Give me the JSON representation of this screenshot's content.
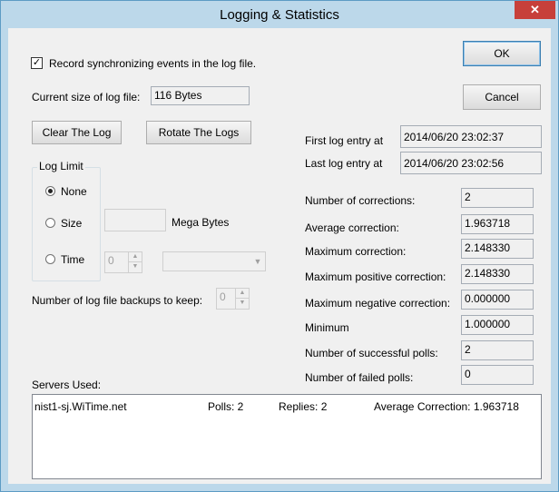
{
  "window": {
    "title": "Logging & Statistics",
    "close_glyph": "✕"
  },
  "buttons": {
    "ok": "OK",
    "cancel": "Cancel",
    "clear_log": "Clear The Log",
    "rotate_logs": "Rotate The Logs"
  },
  "record_events": {
    "checked": true,
    "check_glyph": "✓",
    "label": "Record synchronizing events in the log file."
  },
  "log_size": {
    "label": "Current size of log file:",
    "value": "116 Bytes"
  },
  "log_limit": {
    "group_label": "Log Limit",
    "selected": "None",
    "options": {
      "none": "None",
      "size": "Size",
      "time": "Time"
    },
    "size_value": "",
    "size_unit": "Mega Bytes",
    "time_value": "0",
    "time_unit_value": ""
  },
  "backups": {
    "label": "Number of log file backups to keep:",
    "value": "0"
  },
  "entries": {
    "first_label": "First log entry at",
    "first_value": "2014/06/20 23:02:37",
    "last_label": "Last log entry at",
    "last_value": "2014/06/20 23:02:56"
  },
  "stats": [
    {
      "label": "Number of corrections:",
      "value": "2"
    },
    {
      "label": "Average correction:",
      "value": "1.963718"
    },
    {
      "label": "Maximum correction:",
      "value": "2.148330"
    },
    {
      "label": "Maximum positive correction:",
      "value": "2.148330"
    },
    {
      "label": "Maximum negative correction:",
      "value": "0.000000"
    },
    {
      "label": "Minimum",
      "value": "1.000000"
    },
    {
      "label": "Number of successful polls:",
      "value": "2"
    },
    {
      "label": "Number of failed polls:",
      "value": "0"
    }
  ],
  "servers": {
    "label": "Servers Used:",
    "rows": [
      {
        "name": "nist1-sj.WiTime.net",
        "polls": "Polls: 2",
        "replies": "Replies: 2",
        "avg": "Average Correction: 1.963718"
      }
    ]
  },
  "icons": {
    "spin_up": "▲",
    "spin_down": "▼",
    "combo_arrow": "▼"
  }
}
